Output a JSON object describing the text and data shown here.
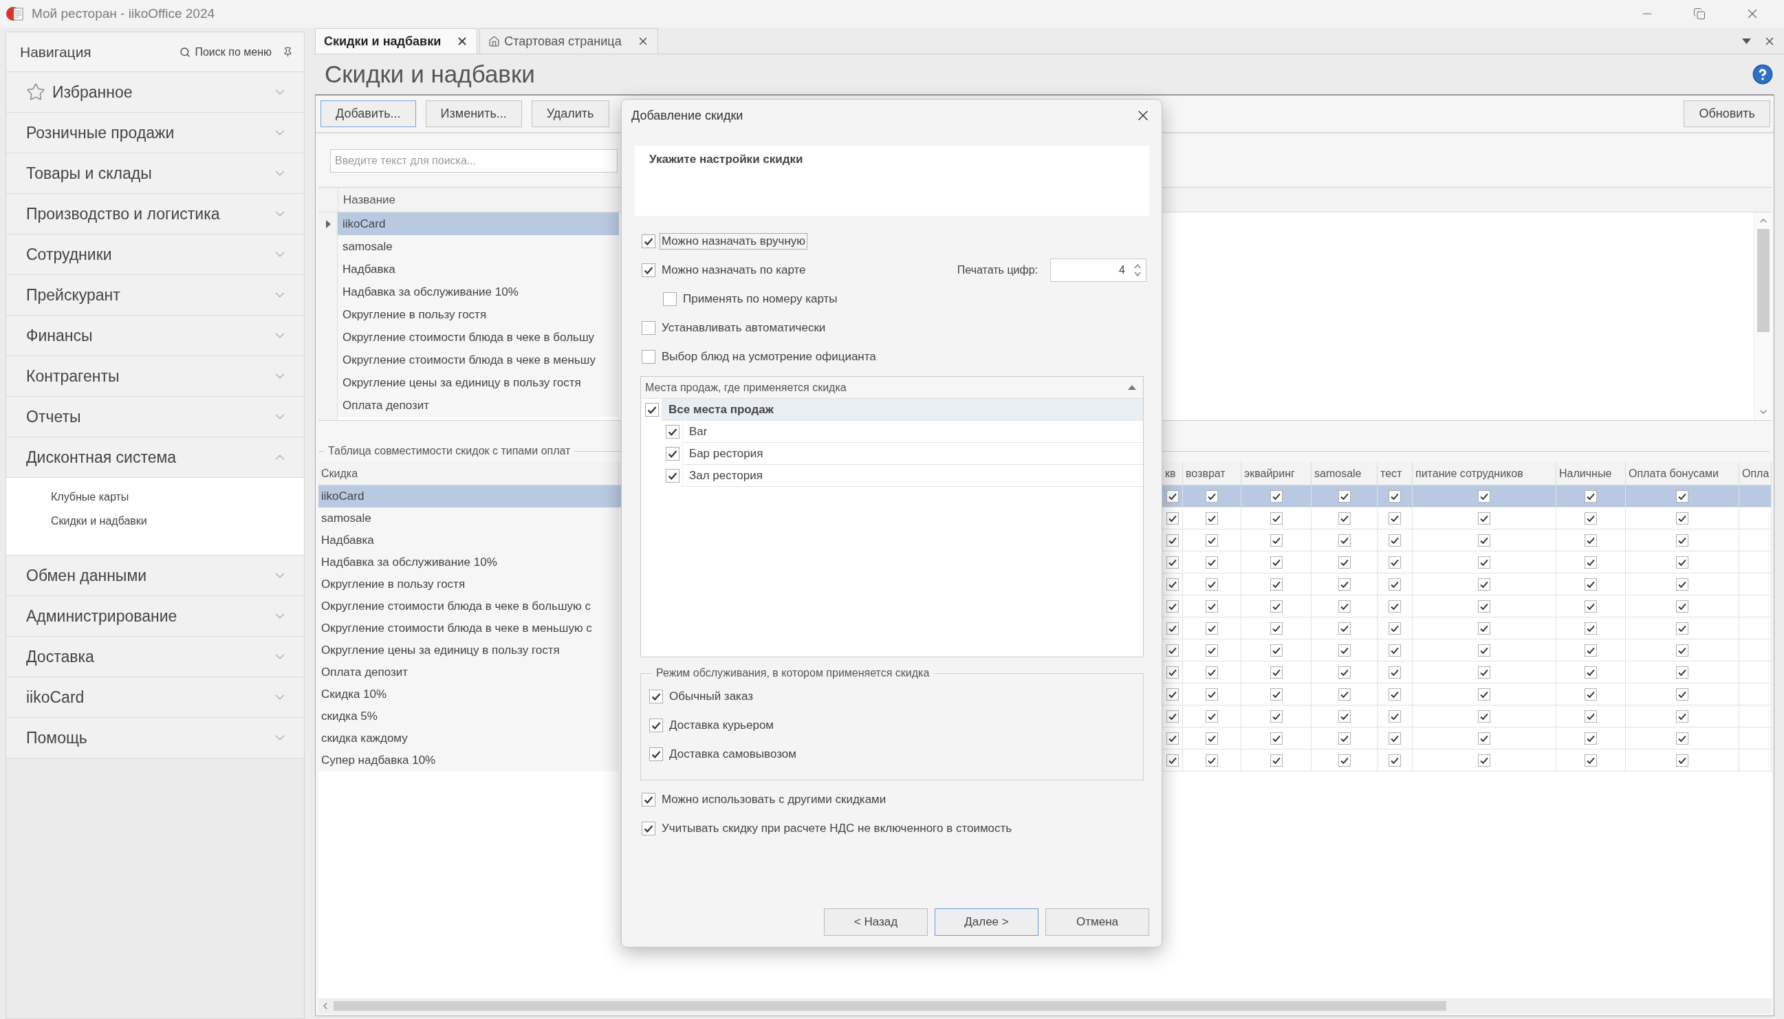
{
  "window": {
    "title": "Мой ресторан - iikoOffice 2024"
  },
  "navigation": {
    "title": "Навигация",
    "search_label": "Поиск по меню",
    "items": [
      {
        "label": "Избранное",
        "kind": "favorites",
        "expanded": false
      },
      {
        "label": "Розничные продажи",
        "kind": "section",
        "expanded": false
      },
      {
        "label": "Товары и склады",
        "kind": "section",
        "expanded": false
      },
      {
        "label": "Производство и логистика",
        "kind": "section",
        "expanded": false
      },
      {
        "label": "Сотрудники",
        "kind": "section",
        "expanded": false
      },
      {
        "label": "Прейскурант",
        "kind": "section",
        "expanded": false
      },
      {
        "label": "Финансы",
        "kind": "section",
        "expanded": false
      },
      {
        "label": "Контрагенты",
        "kind": "section",
        "expanded": false
      },
      {
        "label": "Отчеты",
        "kind": "section",
        "expanded": false
      },
      {
        "label": "Дисконтная система",
        "kind": "section",
        "expanded": true,
        "children": [
          {
            "label": "Клубные карты",
            "selected": false
          },
          {
            "label": "Скидки и надбавки",
            "selected": false
          }
        ]
      },
      {
        "label": "Обмен данными",
        "kind": "section",
        "expanded": false
      },
      {
        "label": "Администрирование",
        "kind": "section",
        "expanded": false
      },
      {
        "label": "Доставка",
        "kind": "section",
        "expanded": false
      },
      {
        "label": "iikoCard",
        "kind": "section",
        "expanded": false
      },
      {
        "label": "Помощь",
        "kind": "section",
        "expanded": false
      }
    ]
  },
  "tabs": [
    {
      "label": "Скидки и надбавки",
      "kind": "page",
      "selected": true
    },
    {
      "label": "Стартовая страница",
      "kind": "home",
      "selected": false
    }
  ],
  "page": {
    "title": "Скидки и надбавки",
    "toolbar": {
      "buttons": [
        {
          "label": "Добавить...",
          "focused": true
        },
        {
          "label": "Изменить...",
          "focused": false
        },
        {
          "label": "Удалить",
          "focused": false
        }
      ],
      "right_buttons": [
        {
          "label": "Обновить",
          "focused": false
        }
      ]
    },
    "search": {
      "placeholder": "Введите текст для поиска..."
    },
    "list": {
      "columns": [
        "Название"
      ],
      "rows": [
        {
          "name": "iikoCard",
          "selected": true
        },
        {
          "name": "samosale",
          "selected": false
        },
        {
          "name": "Надбавка",
          "selected": false
        },
        {
          "name": "Надбавка за обслуживание 10%",
          "selected": false
        },
        {
          "name": "Округление в пользу гостя",
          "selected": false
        },
        {
          "name": "Округление стоимости блюда в чеке в большу",
          "selected": false
        },
        {
          "name": "Округление стоимости блюда в чеке в меньшу",
          "selected": false
        },
        {
          "name": "Округление цены за единицу в пользу гостя",
          "selected": false
        },
        {
          "name": "Оплата депозит",
          "selected": false
        }
      ]
    },
    "compatibility": {
      "title": "Таблица совместимости скидок с типами оплат",
      "columns": [
        "Скидка",
        "кв",
        "возврат",
        "эквайринг",
        "samosale",
        "тест",
        "питание сотрудников",
        "Наличные",
        "Оплата бонусами",
        "Опла"
      ],
      "rows": [
        {
          "name": "iikoCard",
          "selected": true,
          "checks": [
            true,
            true,
            true,
            true,
            true,
            true,
            true,
            true
          ]
        },
        {
          "name": "samosale",
          "selected": false,
          "checks": [
            true,
            true,
            true,
            true,
            true,
            true,
            true,
            true
          ]
        },
        {
          "name": "Надбавка",
          "selected": false,
          "checks": [
            true,
            true,
            true,
            true,
            true,
            true,
            true,
            true
          ]
        },
        {
          "name": "Надбавка за обслуживание 10%",
          "selected": false,
          "checks": [
            true,
            true,
            true,
            true,
            true,
            true,
            true,
            true
          ]
        },
        {
          "name": "Округление в пользу гостя",
          "selected": false,
          "checks": [
            true,
            true,
            true,
            true,
            true,
            true,
            true,
            true
          ]
        },
        {
          "name": "Округление стоимости блюда в чеке в большую с",
          "selected": false,
          "checks": [
            true,
            true,
            true,
            true,
            true,
            true,
            true,
            true
          ]
        },
        {
          "name": "Округление стоимости блюда в чеке в меньшую с",
          "selected": false,
          "checks": [
            true,
            true,
            true,
            true,
            true,
            true,
            true,
            true
          ]
        },
        {
          "name": "Округление цены за единицу в пользу гостя",
          "selected": false,
          "checks": [
            true,
            true,
            true,
            true,
            true,
            true,
            true,
            true
          ]
        },
        {
          "name": "Оплата депозит",
          "selected": false,
          "checks": [
            true,
            true,
            true,
            true,
            true,
            true,
            true,
            true
          ]
        },
        {
          "name": "Скидка 10%",
          "selected": false,
          "checks": [
            true,
            true,
            true,
            true,
            true,
            true,
            true,
            true
          ]
        },
        {
          "name": "скидка 5%",
          "selected": false,
          "checks": [
            true,
            true,
            true,
            true,
            true,
            true,
            true,
            true
          ]
        },
        {
          "name": "скидка каждому",
          "selected": false,
          "checks": [
            true,
            true,
            true,
            true,
            true,
            true,
            true,
            true
          ]
        },
        {
          "name": "Супер надбавка 10%",
          "selected": false,
          "checks": [
            true,
            true,
            true,
            true,
            true,
            true,
            true,
            true
          ]
        }
      ]
    }
  },
  "dialog": {
    "title": "Добавление скидки",
    "heading": "Укажите настройки скидки",
    "options": [
      {
        "label": "Можно назначать вручную",
        "checked": true,
        "focused": true
      },
      {
        "label": "Можно назначать по карте",
        "checked": true,
        "focused": false,
        "spin": {
          "label": "Печатать цифр:",
          "value": "4"
        },
        "children": [
          {
            "label": "Применять по номеру карты",
            "checked": false,
            "focused": false
          }
        ]
      },
      {
        "label": "Устанавливать автоматически",
        "checked": false,
        "focused": false
      },
      {
        "label": "Выбор блюд на усмотрение официанта",
        "checked": false,
        "focused": false
      }
    ],
    "sales_points": {
      "title": "Места продаж, где применяется скидка",
      "expanded": true,
      "items": [
        {
          "label": "Все места продаж",
          "checked": true,
          "selected": true,
          "children": [
            {
              "label": "Bar",
              "checked": true,
              "selected": false
            },
            {
              "label": "Бар рестория",
              "checked": true,
              "selected": false
            },
            {
              "label": "Зал рестория",
              "checked": true,
              "selected": false
            }
          ]
        }
      ]
    },
    "service_modes": {
      "title": "Режим обслуживания, в котором применяется скидка",
      "items": [
        {
          "label": "Обычный заказ",
          "checked": true
        },
        {
          "label": "Доставка курьером",
          "checked": true
        },
        {
          "label": "Доставка самовывозом",
          "checked": true
        }
      ]
    },
    "extra_options": [
      {
        "label": "Можно использовать с другими скидками",
        "checked": true
      },
      {
        "label": "Учитывать скидку при расчете НДС не включенного в стоимость",
        "checked": true
      }
    ],
    "buttons": [
      {
        "label": "< Назад",
        "focused": false
      },
      {
        "label": "Далее >",
        "focused": true
      },
      {
        "label": "Отмена",
        "focused": false
      }
    ]
  }
}
